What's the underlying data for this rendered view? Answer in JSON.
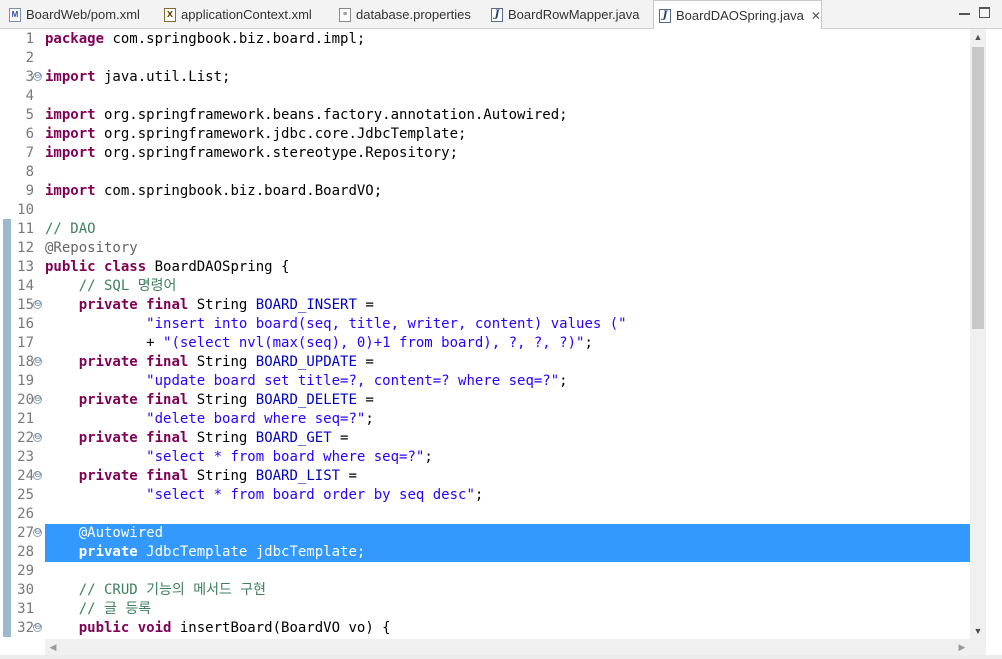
{
  "tabs": [
    {
      "label": "BoardWeb/pom.xml",
      "icon": "maven-pom-file-icon"
    },
    {
      "label": "applicationContext.xml",
      "icon": "xml-file-icon"
    },
    {
      "label": "database.properties",
      "icon": "properties-file-icon"
    },
    {
      "label": "BoardRowMapper.java",
      "icon": "java-file-icon"
    },
    {
      "label": "BoardDAOSpring.java",
      "icon": "java-file-icon",
      "active": true,
      "close": "✕"
    }
  ],
  "window_controls": {
    "minimize": "minimize-icon",
    "maximize": "maximize-icon"
  },
  "colors": {
    "keyword": "#7f0055",
    "string": "#2a00ff",
    "comment": "#3f7f5f",
    "annotation": "#646464",
    "field": "#0000c0",
    "selection": "#3399ff"
  },
  "editor": {
    "lines": [
      {
        "n": "1",
        "tokens": [
          {
            "t": "kw",
            "v": "package"
          },
          {
            "t": "n",
            "v": " com.springbook.biz.board.impl;"
          }
        ]
      },
      {
        "n": "2",
        "tokens": []
      },
      {
        "n": "3",
        "fold": "⊖",
        "tokens": [
          {
            "t": "kw",
            "v": "import"
          },
          {
            "t": "n",
            "v": " java.util.List;"
          }
        ]
      },
      {
        "n": "4",
        "tokens": []
      },
      {
        "n": "5",
        "tokens": [
          {
            "t": "kw",
            "v": "import"
          },
          {
            "t": "n",
            "v": " org.springframework.beans.factory.annotation.Autowired;"
          }
        ]
      },
      {
        "n": "6",
        "tokens": [
          {
            "t": "kw",
            "v": "import"
          },
          {
            "t": "n",
            "v": " org.springframework.jdbc.core.JdbcTemplate;"
          }
        ]
      },
      {
        "n": "7",
        "tokens": [
          {
            "t": "kw",
            "v": "import"
          },
          {
            "t": "n",
            "v": " org.springframework.stereotype.Repository;"
          }
        ]
      },
      {
        "n": "8",
        "tokens": []
      },
      {
        "n": "9",
        "tokens": [
          {
            "t": "kw",
            "v": "import"
          },
          {
            "t": "n",
            "v": " com.springbook.biz.board.BoardVO;"
          }
        ]
      },
      {
        "n": "10",
        "tokens": []
      },
      {
        "n": "11",
        "tokens": [
          {
            "t": "com",
            "v": "// DAO"
          }
        ]
      },
      {
        "n": "12",
        "tokens": [
          {
            "t": "ann",
            "v": "@Repository"
          }
        ]
      },
      {
        "n": "13",
        "tokens": [
          {
            "t": "kw",
            "v": "public"
          },
          {
            "t": "n",
            "v": " "
          },
          {
            "t": "kw",
            "v": "class"
          },
          {
            "t": "n",
            "v": " BoardDAOSpring {"
          }
        ]
      },
      {
        "n": "14",
        "tokens": [
          {
            "t": "n",
            "v": "    "
          },
          {
            "t": "com",
            "v": "// SQL 명령어"
          }
        ]
      },
      {
        "n": "15",
        "fold": "⊖",
        "tokens": [
          {
            "t": "n",
            "v": "    "
          },
          {
            "t": "kw",
            "v": "private"
          },
          {
            "t": "n",
            "v": " "
          },
          {
            "t": "kw",
            "v": "final"
          },
          {
            "t": "n",
            "v": " String "
          },
          {
            "t": "fld",
            "v": "BOARD_INSERT"
          },
          {
            "t": "n",
            "v": " ="
          }
        ]
      },
      {
        "n": "16",
        "tokens": [
          {
            "t": "n",
            "v": "            "
          },
          {
            "t": "str",
            "v": "\"insert into board(seq, title, writer, content) values (\""
          }
        ]
      },
      {
        "n": "17",
        "tokens": [
          {
            "t": "n",
            "v": "            + "
          },
          {
            "t": "str",
            "v": "\"(select nvl(max(seq), 0)+1 from board), ?, ?, ?)\""
          },
          {
            "t": "n",
            "v": ";"
          }
        ]
      },
      {
        "n": "18",
        "fold": "⊖",
        "tokens": [
          {
            "t": "n",
            "v": "    "
          },
          {
            "t": "kw",
            "v": "private"
          },
          {
            "t": "n",
            "v": " "
          },
          {
            "t": "kw",
            "v": "final"
          },
          {
            "t": "n",
            "v": " String "
          },
          {
            "t": "fld",
            "v": "BOARD_UPDATE"
          },
          {
            "t": "n",
            "v": " ="
          }
        ]
      },
      {
        "n": "19",
        "tokens": [
          {
            "t": "n",
            "v": "            "
          },
          {
            "t": "str",
            "v": "\"update board set title=?, content=? where seq=?\""
          },
          {
            "t": "n",
            "v": ";"
          }
        ]
      },
      {
        "n": "20",
        "fold": "⊖",
        "tokens": [
          {
            "t": "n",
            "v": "    "
          },
          {
            "t": "kw",
            "v": "private"
          },
          {
            "t": "n",
            "v": " "
          },
          {
            "t": "kw",
            "v": "final"
          },
          {
            "t": "n",
            "v": " String "
          },
          {
            "t": "fld",
            "v": "BOARD_DELETE"
          },
          {
            "t": "n",
            "v": " ="
          }
        ]
      },
      {
        "n": "21",
        "tokens": [
          {
            "t": "n",
            "v": "            "
          },
          {
            "t": "str",
            "v": "\"delete board where seq=?\""
          },
          {
            "t": "n",
            "v": ";"
          }
        ]
      },
      {
        "n": "22",
        "fold": "⊖",
        "tokens": [
          {
            "t": "n",
            "v": "    "
          },
          {
            "t": "kw",
            "v": "private"
          },
          {
            "t": "n",
            "v": " "
          },
          {
            "t": "kw",
            "v": "final"
          },
          {
            "t": "n",
            "v": " String "
          },
          {
            "t": "fld",
            "v": "BOARD_GET"
          },
          {
            "t": "n",
            "v": " ="
          }
        ]
      },
      {
        "n": "23",
        "tokens": [
          {
            "t": "n",
            "v": "            "
          },
          {
            "t": "str",
            "v": "\"select * from board where seq=?\""
          },
          {
            "t": "n",
            "v": ";"
          }
        ]
      },
      {
        "n": "24",
        "fold": "⊖",
        "tokens": [
          {
            "t": "n",
            "v": "    "
          },
          {
            "t": "kw",
            "v": "private"
          },
          {
            "t": "n",
            "v": " "
          },
          {
            "t": "kw",
            "v": "final"
          },
          {
            "t": "n",
            "v": " String "
          },
          {
            "t": "fld",
            "v": "BOARD_LIST"
          },
          {
            "t": "n",
            "v": " ="
          }
        ]
      },
      {
        "n": "25",
        "tokens": [
          {
            "t": "n",
            "v": "            "
          },
          {
            "t": "str",
            "v": "\"select * from board order by seq desc\""
          },
          {
            "t": "n",
            "v": ";"
          }
        ]
      },
      {
        "n": "26",
        "tokens": []
      },
      {
        "n": "27",
        "fold": "⊖",
        "selected": true,
        "tokens": [
          {
            "t": "n",
            "v": "    "
          },
          {
            "t": "ann",
            "v": "@Autowired"
          }
        ]
      },
      {
        "n": "28",
        "selected": true,
        "tokens": [
          {
            "t": "n",
            "v": "    "
          },
          {
            "t": "kw",
            "v": "private"
          },
          {
            "t": "n",
            "v": " JdbcTemplate jdbcTemplate;"
          }
        ]
      },
      {
        "n": "29",
        "tokens": []
      },
      {
        "n": "30",
        "tokens": [
          {
            "t": "n",
            "v": "    "
          },
          {
            "t": "com",
            "v": "// CRUD 기능의 메서드 구현"
          }
        ]
      },
      {
        "n": "31",
        "tokens": [
          {
            "t": "n",
            "v": "    "
          },
          {
            "t": "com",
            "v": "// 글 등록"
          }
        ]
      },
      {
        "n": "32",
        "fold": "⊖",
        "tokens": [
          {
            "t": "n",
            "v": "    "
          },
          {
            "t": "kw",
            "v": "public"
          },
          {
            "t": "n",
            "v": " "
          },
          {
            "t": "kw",
            "v": "void"
          },
          {
            "t": "n",
            "v": " insertBoard(BoardVO vo) {"
          }
        ]
      }
    ]
  },
  "scroll": {
    "up": "▲",
    "down": "▼",
    "left": "◀",
    "right": "▶"
  }
}
